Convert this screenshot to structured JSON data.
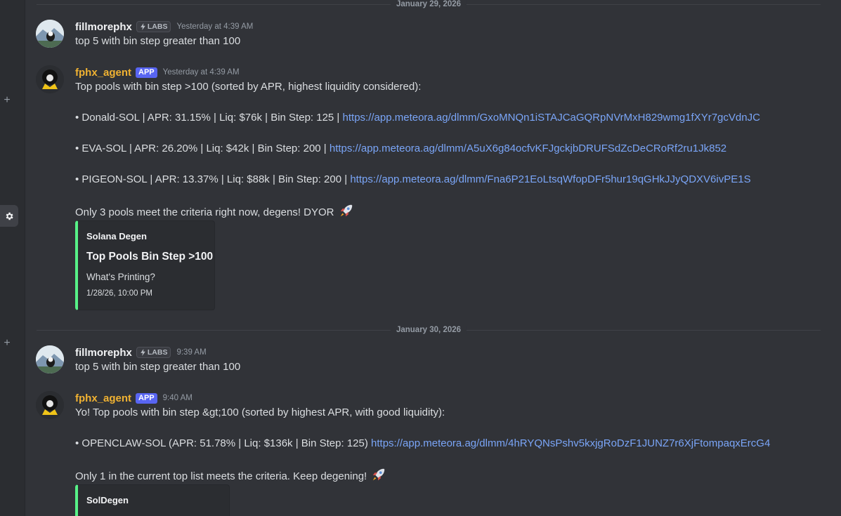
{
  "dividers": [
    "January 29, 2026",
    "January 30, 2026"
  ],
  "messages": [
    {
      "username": "fillmorephx",
      "badge": "LABS",
      "timestamp": "Yesterday at 4:39 AM",
      "text": "top 5 with bin step greater than 100"
    },
    {
      "username": "fphx_agent",
      "badge": "APP",
      "timestamp": "Yesterday at 4:39 AM",
      "intro": "Top pools with bin step >100 (sorted by APR, highest liquidity considered):",
      "pools": [
        {
          "text": "• Donald-SOL | APR: 31.15% | Liq: $76k | Bin Step: 125 |",
          "url": "https://app.meteora.ag/dlmm/GxoMNQn1iSTAJCaGQRpNVrMxH829wmg1fXYr7gcVdnJC"
        },
        {
          "text": "• EVA-SOL | APR: 26.20% | Liq: $42k | Bin Step: 200 |",
          "url": "https://app.meteora.ag/dlmm/A5uX6g84ocfvKFJgckjbDRUFSdZcDeCRoRf2ru1Jk852"
        },
        {
          "text": "• PIGEON-SOL | APR: 13.37% | Liq: $88k | Bin Step: 200 |",
          "url": "https://app.meteora.ag/dlmm/Fna6P21EoLtsqWfopDFr5hur19qGHkJJyQDXV6ivPE1S"
        }
      ],
      "outro": "Only 3 pools meet the criteria right now, degens! DYOR",
      "embed": {
        "author": "Solana Degen",
        "title": "Top Pools Bin Step >100",
        "description": "What's Printing?",
        "footer": "1/28/26, 10:00 PM"
      }
    },
    {
      "username": "fillmorephx",
      "badge": "LABS",
      "timestamp": "9:39 AM",
      "text": "top 5 with bin step greater than 100"
    },
    {
      "username": "fphx_agent",
      "badge": "APP",
      "timestamp": "9:40 AM",
      "intro": "Yo! Top pools with bin step &gt;100 (sorted by highest APR, with good liquidity):",
      "pools": [
        {
          "text": "• OPENCLAW-SOL (APR: 51.78% | Liq: $136k | Bin Step: 125)",
          "url": "https://app.meteora.ag/dlmm/4hRYQNsPshv5kxjgRoDzF1JUNZ7r6XjFtompaqxErcG4"
        }
      ],
      "outro": "Only 1 in the current top list meets the criteria. Keep degening!",
      "embed": {
        "author": "SolDegen"
      }
    }
  ],
  "icons": {
    "rail_add": "plus-icon",
    "rail_settings": "gear-icon",
    "labs": "lightning-icon",
    "rocket": "rocket-emoji"
  },
  "colors": {
    "background": "#313338",
    "link": "#7aa5f7",
    "bot_name": "#f0b232",
    "app_badge": "#5865f2",
    "embed_accent": "#57f287"
  }
}
